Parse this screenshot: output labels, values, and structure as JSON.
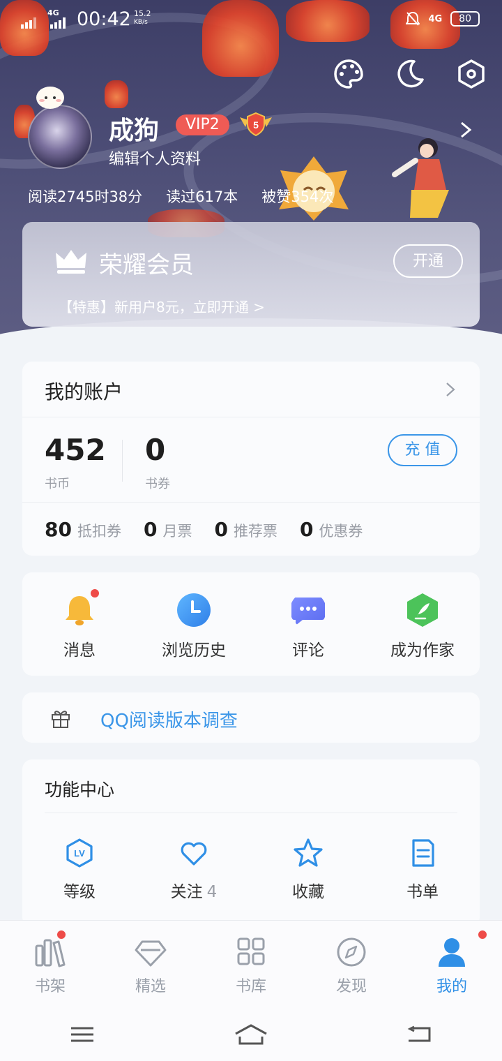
{
  "status_bar": {
    "network": "4G",
    "time": "00:42",
    "speed_value": "15.2",
    "speed_unit": "KB/s",
    "network2": "4G",
    "battery": "80"
  },
  "profile": {
    "name": "成狗",
    "vip_badge": "VIP2",
    "level_medal": "5",
    "edit_label": "编辑个人资料",
    "stats": [
      "阅读2745时38分",
      "读过617本",
      "被赞354次"
    ]
  },
  "vip_card": {
    "title": "荣耀会员",
    "open_button": "开通",
    "promo": "【特惠】新用户8元，立即开通 >"
  },
  "account": {
    "title": "我的账户",
    "coins_value": "452",
    "coins_label": "书币",
    "coupons_value": "0",
    "coupons_label": "书券",
    "recharge_button": "充 值",
    "tickets": [
      {
        "value": "80",
        "label": "抵扣券"
      },
      {
        "value": "0",
        "label": "月票"
      },
      {
        "value": "0",
        "label": "推荐票"
      },
      {
        "value": "0",
        "label": "优惠券"
      }
    ]
  },
  "quick_actions": [
    {
      "label": "消息",
      "icon": "bell-icon"
    },
    {
      "label": "浏览历史",
      "icon": "clock-icon"
    },
    {
      "label": "评论",
      "icon": "comment-icon"
    },
    {
      "label": "成为作家",
      "icon": "quill-icon"
    }
  ],
  "survey": {
    "label": "QQ阅读版本调查",
    "icon": "gift-icon"
  },
  "function_center": {
    "title": "功能中心",
    "items": [
      {
        "label": "等级",
        "count": "",
        "icon": "level-icon"
      },
      {
        "label": "关注",
        "count": "4",
        "icon": "heart-icon"
      },
      {
        "label": "收藏",
        "count": "",
        "icon": "star-icon"
      },
      {
        "label": "书单",
        "count": "",
        "icon": "booklist-icon"
      }
    ]
  },
  "tabs": [
    {
      "label": "书架",
      "icon": "bookshelf-icon",
      "active": false
    },
    {
      "label": "精选",
      "icon": "diamond-icon",
      "active": false
    },
    {
      "label": "书库",
      "icon": "grid-icon",
      "active": false
    },
    {
      "label": "发现",
      "icon": "compass-icon",
      "active": false
    },
    {
      "label": "我的",
      "icon": "user-icon",
      "active": true
    }
  ],
  "colors": {
    "accent": "#2f8fe6",
    "vip_red": "#ef5b55",
    "badge_red": "#ee4b48",
    "header_bg": "#44456e"
  }
}
